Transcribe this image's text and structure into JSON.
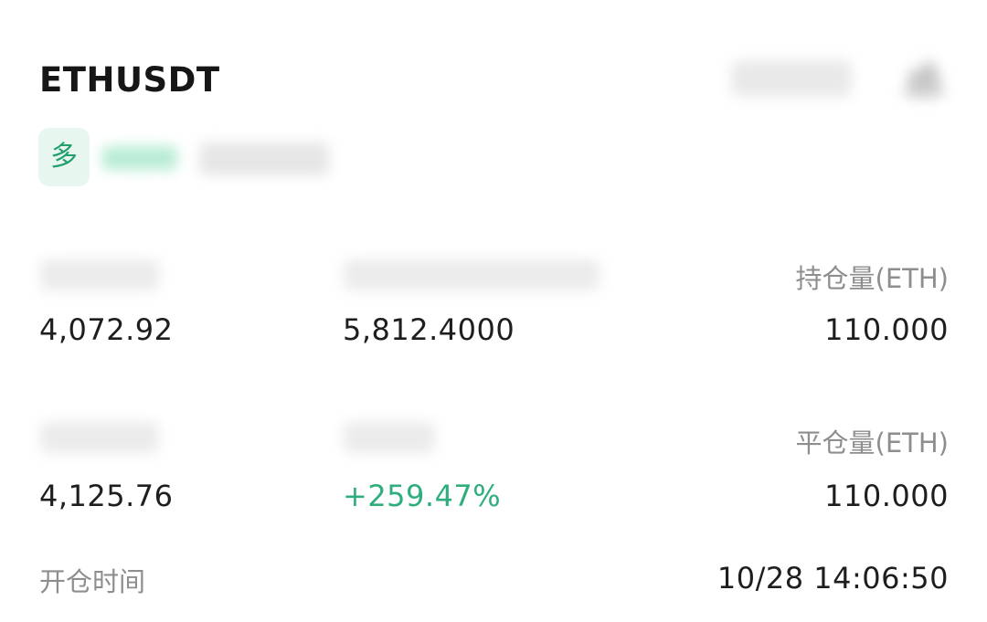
{
  "position": {
    "symbol": "ETHUSDT",
    "side_tag": "多"
  },
  "stats": {
    "entry_price_value": "4,072.92",
    "realized_value": "5,812.4000",
    "holding_label": "持仓量(ETH)",
    "holding_value": "110.000",
    "close_price_value": "4,125.76",
    "roi_value": "+259.47%",
    "closed_label": "平仓量(ETH)",
    "closed_value": "110.000",
    "open_time_label": "开仓时间",
    "open_time_value": "10/28 14:06:50"
  },
  "colors": {
    "accent_green": "#2fae7c",
    "tag_bg": "#e7f6ee"
  }
}
